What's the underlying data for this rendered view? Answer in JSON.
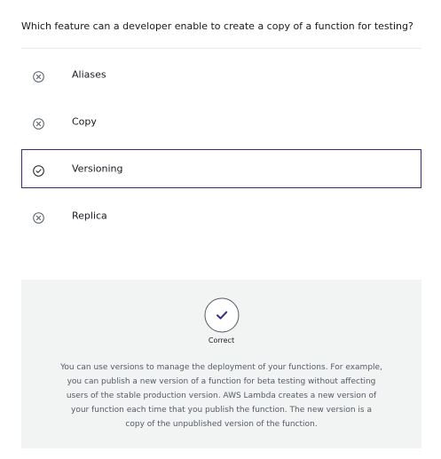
{
  "quiz": {
    "question": "Which feature can a developer enable to create a copy of a function for testing?",
    "options": [
      {
        "label": "Aliases",
        "state": "incorrect",
        "icon": "x-circle-icon"
      },
      {
        "label": "Copy",
        "state": "incorrect",
        "icon": "x-circle-icon"
      },
      {
        "label": "Versioning",
        "state": "selected-correct",
        "icon": "check-circle-icon"
      },
      {
        "label": "Replica",
        "state": "incorrect",
        "icon": "x-circle-icon"
      }
    ],
    "feedback": {
      "status": "Correct",
      "icon": "check-circle-icon",
      "explanation": "You can use versions to manage the deployment of your functions. For example, you can publish a new version of a function for beta testing without affecting users of the stable production version. AWS Lambda creates a new version of your function each time that you publish the function. The new version is a copy of the unpublished version of the function."
    }
  },
  "colors": {
    "accent": "#3b2a80",
    "icon": "#545b64",
    "panel": "#f2f3f3"
  }
}
